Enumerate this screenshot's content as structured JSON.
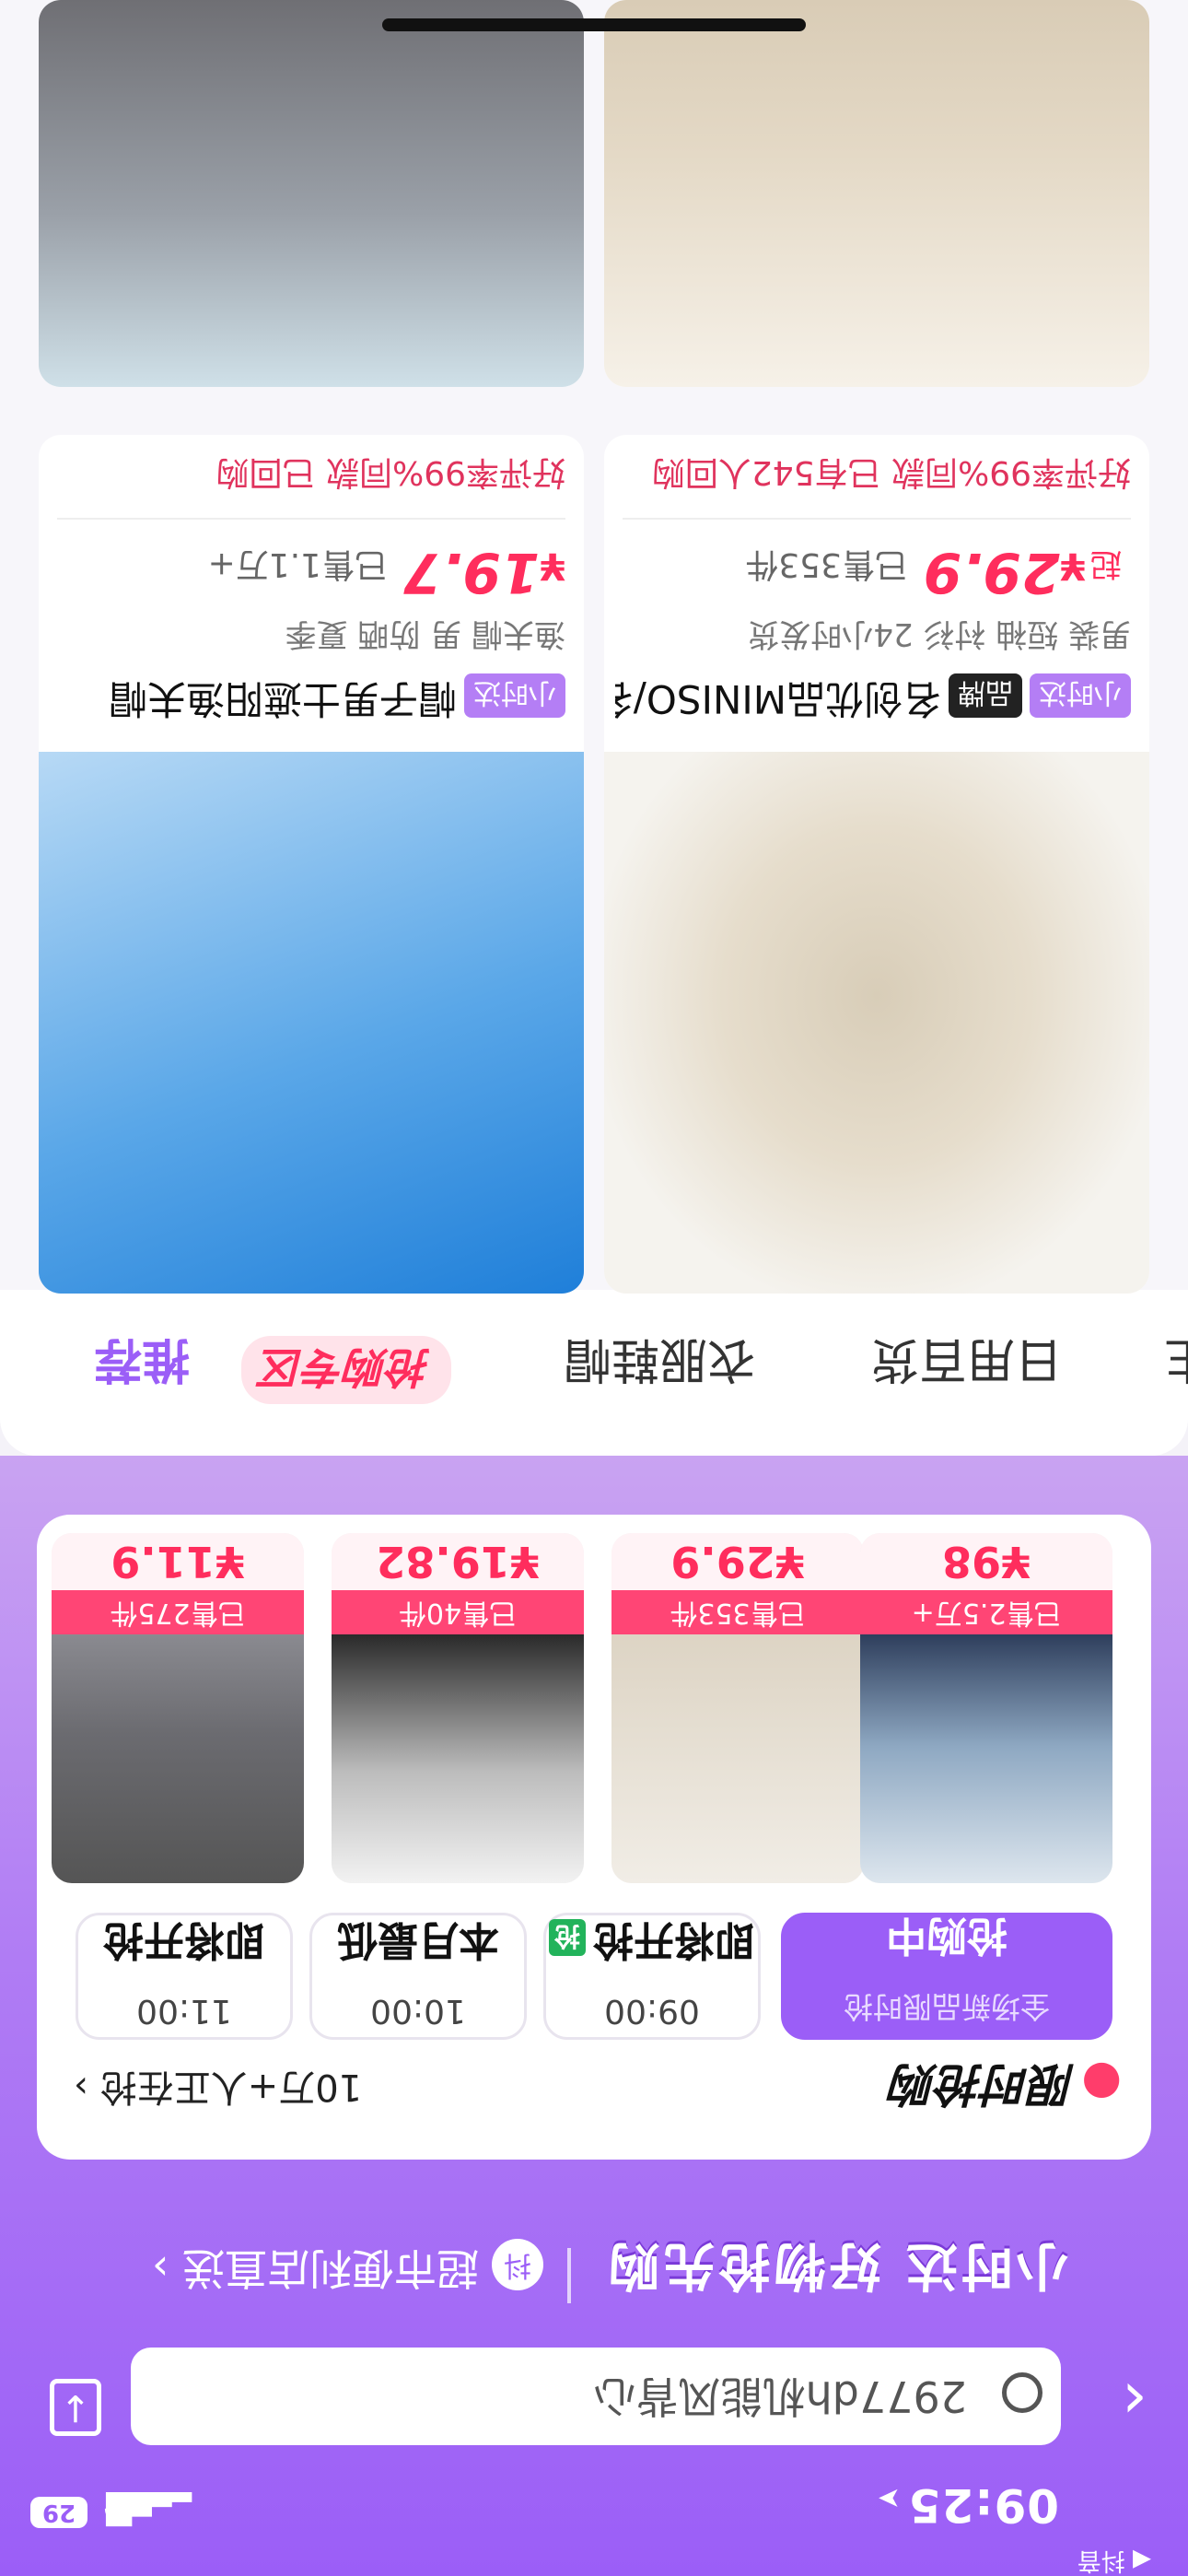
{
  "status_bar": {
    "time": "09:25",
    "back_app": "抖音",
    "battery": "29"
  },
  "search": {
    "query": "2977dh机能风背心"
  },
  "promo": {
    "left_text": "小时达 好物抢先购",
    "store_text": "超市便利店直送"
  },
  "flash_sale": {
    "title": "限时抢购",
    "more_text": "10万+人正在抢",
    "slots": [
      {
        "time": "11:00",
        "label": "即将开抢",
        "chip": ""
      },
      {
        "time": "10:00",
        "label": "本月最低",
        "chip": ""
      },
      {
        "time": "09:00",
        "label": "即将开抢",
        "chip": "抢"
      },
      {
        "time": "",
        "label": "抢购中",
        "sub": "全场新品限时抢"
      }
    ],
    "items": [
      {
        "price": "¥11.9",
        "tag": "已售275件"
      },
      {
        "price": "¥19.82",
        "tag": "已售40件"
      },
      {
        "price": "¥29.9",
        "tag": "已售353件"
      },
      {
        "price": "¥98",
        "tag": "已售2.5万+"
      }
    ]
  },
  "tabs": {
    "items": [
      "推荐",
      "抢购专区",
      "衣服鞋帽",
      "日用百货",
      "生"
    ],
    "sale_label": "抢购专区"
  },
  "products": [
    {
      "name": "名创优品MINISO/名",
      "badge_dark": "品牌",
      "badge_purple": "小时达",
      "tags": "男装 短袖 衬衫 24小时发货",
      "price_cur": "¥",
      "price": "29.9",
      "sold": "已售353件",
      "foot": "好评率99%同款 已有542人回购"
    },
    {
      "name": "帽子男士遮阳渔夫帽",
      "badge_dark": "",
      "badge_purple": "小时达",
      "tags": "渔夫帽 男 防晒 夏季",
      "price_cur": "¥",
      "price": "19.7",
      "sold": "已售1.1万+",
      "foot": "好评率99%同款 已回购"
    }
  ],
  "colors": {
    "accent": "#9b5ef7",
    "price": "#ff2d5d",
    "bg": "#f7f6fa"
  }
}
